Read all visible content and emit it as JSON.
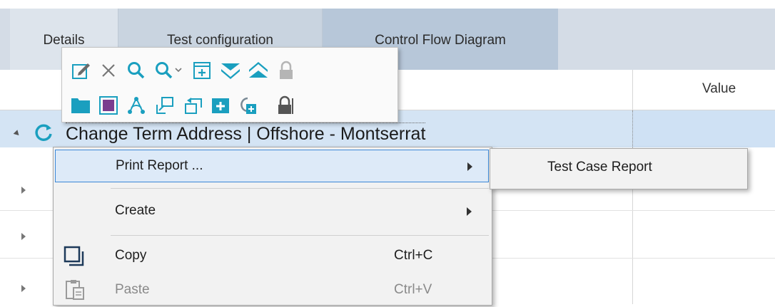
{
  "tabs": [
    {
      "label": "Details"
    },
    {
      "label": "Test configuration"
    },
    {
      "label": "Control Flow Diagram"
    }
  ],
  "grid": {
    "value_header": "Value",
    "selected_row": {
      "text": "Change Term Address | Offshore - Montserrat"
    }
  },
  "toolbar": {
    "row1": [
      "edit-icon",
      "delete-icon",
      "search-icon",
      "search-dropdown-icon",
      "add-column-icon",
      "expand-all-icon",
      "collapse-all-icon",
      "lock-icon"
    ],
    "row2": [
      "folder-icon",
      "module-icon",
      "flow-icon",
      "import-icon",
      "export-icon",
      "add-folder-icon",
      "link-icon",
      "unlock-icon"
    ]
  },
  "context_menu": {
    "items": [
      {
        "label": "Print Report ...",
        "shortcut": "",
        "submenu": true,
        "highlighted": true,
        "disabled": false
      },
      {
        "label": "Create",
        "shortcut": "",
        "submenu": true,
        "highlighted": false,
        "disabled": false
      },
      {
        "label": "Copy",
        "shortcut": "Ctrl+C",
        "submenu": false,
        "highlighted": false,
        "disabled": false
      },
      {
        "label": "Paste",
        "shortcut": "Ctrl+V",
        "submenu": false,
        "highlighted": false,
        "disabled": true
      }
    ]
  },
  "submenu": {
    "items": [
      {
        "label": "Test Case Report"
      }
    ]
  },
  "colors": {
    "accent": "#1a9fbf",
    "selection": "#d4e4f4",
    "highlight_border": "#3b87d6",
    "tab_active": "#dde4ec"
  }
}
